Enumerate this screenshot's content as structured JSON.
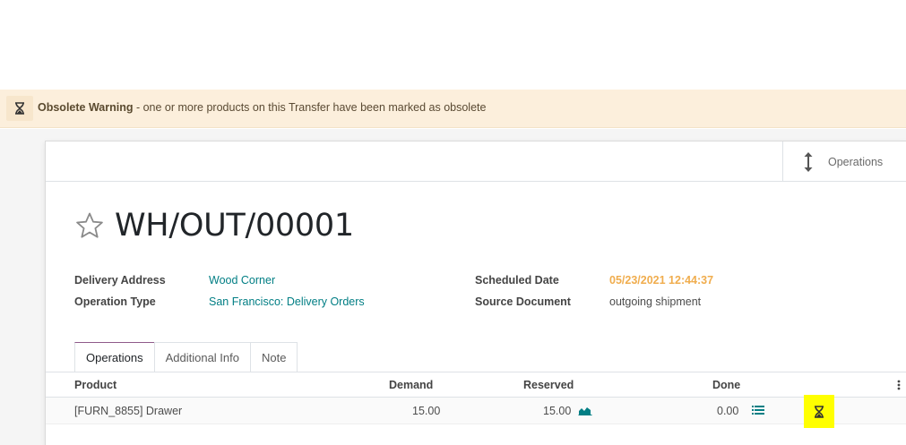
{
  "warning": {
    "icon": "hourglass-icon",
    "title": "Obsolete Warning",
    "message": " - one or more products on this Transfer have been marked as obsolete"
  },
  "button_box": {
    "operations_label": "Operations",
    "operations_icon": "vertical-arrows-icon"
  },
  "record": {
    "name": "WH/OUT/00001",
    "star_icon": "star-outline-icon"
  },
  "fields": {
    "delivery_address": {
      "label": "Delivery Address",
      "value": "Wood Corner"
    },
    "operation_type": {
      "label": "Operation Type",
      "value": "San Francisco: Delivery Orders"
    },
    "scheduled_date": {
      "label": "Scheduled Date",
      "value": "05/23/2021 12:44:37"
    },
    "source_document": {
      "label": "Source Document",
      "value": "outgoing shipment"
    }
  },
  "tabs": [
    {
      "label": "Operations",
      "active": true
    },
    {
      "label": "Additional Info",
      "active": false
    },
    {
      "label": "Note",
      "active": false
    }
  ],
  "table": {
    "columns": [
      "Product",
      "Demand",
      "Reserved",
      "Done"
    ],
    "rows": [
      {
        "product": "[FURN_8855] Drawer",
        "demand": "15.00",
        "reserved": "15.00",
        "done": "0.00"
      }
    ]
  },
  "colors": {
    "accent": "#017e84",
    "warning_bg": "#fcefdc",
    "date_orange": "#f0ad4e",
    "highlight": "#ffff00"
  }
}
